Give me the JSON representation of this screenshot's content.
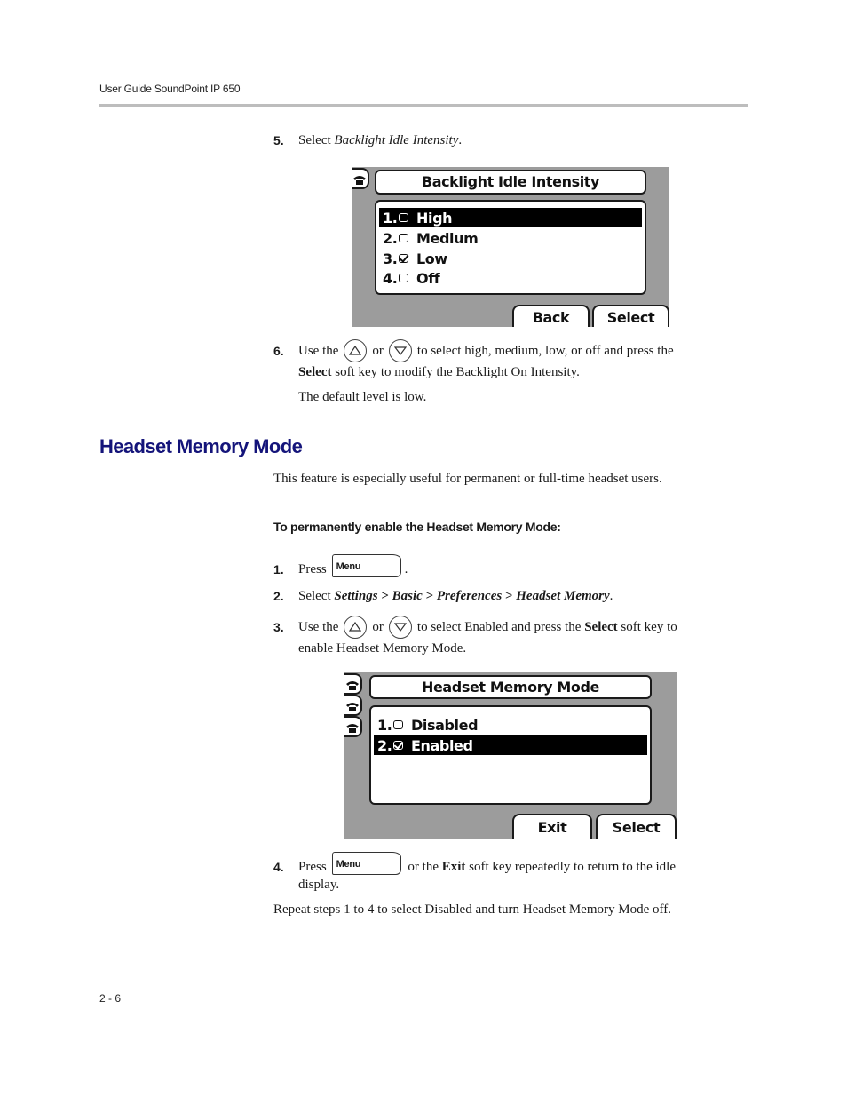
{
  "header": {
    "running_title": "User Guide SoundPoint IP 650"
  },
  "steps_a": [
    {
      "num": "5.",
      "pre": "Select ",
      "italic": "Backlight Idle Intensity",
      "post": "."
    },
    {
      "num": "6.",
      "pre": "Use the",
      "or": "or",
      "post": "to select high, medium, low, or off and press the",
      "line2_bold": "Select",
      "line2_rest": " soft key to modify the Backlight On Intensity.",
      "note": "The default level is low."
    }
  ],
  "screen1": {
    "title": "Backlight Idle Intensity",
    "items": [
      {
        "idx": "1.",
        "label": "High",
        "checked": false,
        "selected": true
      },
      {
        "idx": "2.",
        "label": "Medium",
        "checked": false,
        "selected": false
      },
      {
        "idx": "3.",
        "label": "Low",
        "checked": true,
        "selected": false
      },
      {
        "idx": "4.",
        "label": "Off",
        "checked": false,
        "selected": false
      }
    ],
    "softkeys": [
      "Back",
      "Select"
    ],
    "line_icon": "phone-handset-icon"
  },
  "section": {
    "title": "Headset Memory Mode",
    "intro": "This feature is especially useful for permanent or full-time headset users.",
    "procedure_title": "To permanently enable the Headset Memory Mode:"
  },
  "steps_b": [
    {
      "num": "1.",
      "pre": "Press",
      "key": "Menu",
      "post": "."
    },
    {
      "num": "2.",
      "pre": "Select ",
      "path": [
        "Settings",
        "Basic",
        "Preferences",
        "Headset Memory"
      ],
      "sep": " > ",
      "post": "."
    },
    {
      "num": "3.",
      "pre": "Use the",
      "or": "or",
      "post": "to select Enabled and press the",
      "bold": "Select",
      "post2": " soft key to",
      "line2": "enable Headset Memory Mode."
    },
    {
      "num": "4.",
      "pre": "Press",
      "key": "Menu",
      "post": "or the",
      "bold": "Exit",
      "post2": " soft key repeatedly to return to the idle",
      "line2": "display."
    }
  ],
  "closing": "Repeat steps 1 to 4 to select Disabled and turn Headset Memory Mode off.",
  "screen2": {
    "title": "Headset Memory Mode",
    "items": [
      {
        "idx": "1.",
        "label": "Disabled",
        "checked": false,
        "selected": false
      },
      {
        "idx": "2.",
        "label": "Enabled",
        "checked": true,
        "selected": true
      }
    ],
    "softkeys": [
      "Exit",
      "Select"
    ],
    "line_icons": [
      "phone-handset-icon",
      "phone-handset-icon",
      "phone-handset-icon"
    ]
  },
  "footer": {
    "page_number": "2 - 6"
  }
}
